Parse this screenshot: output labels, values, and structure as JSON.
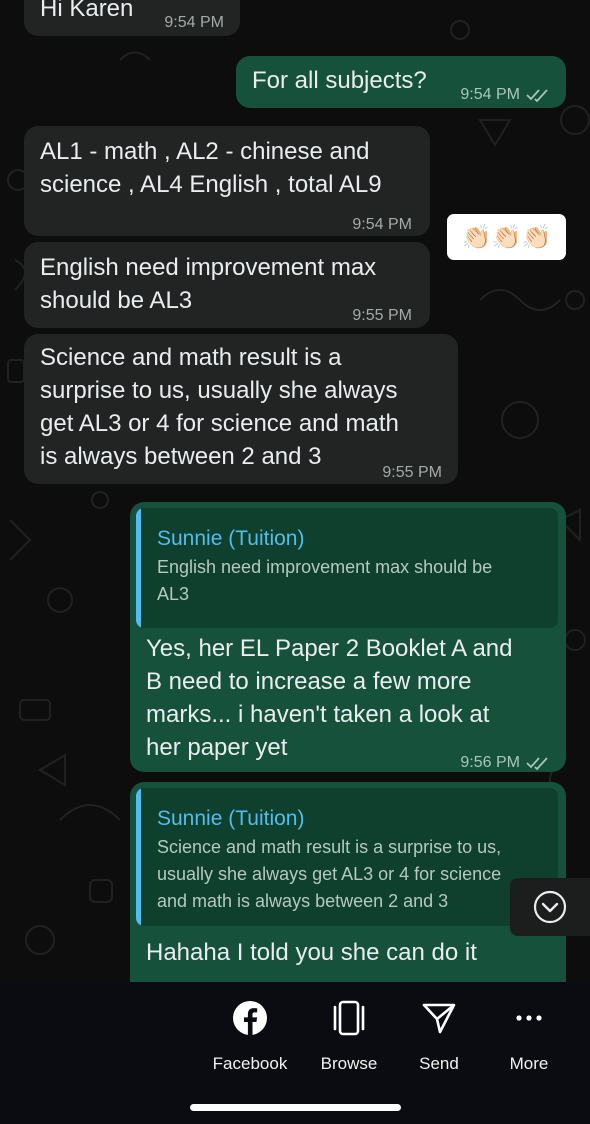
{
  "messages": [
    {
      "text": "Hi Karen",
      "time": "9:54 PM"
    },
    {
      "text": "For all subjects?",
      "time": "9:54 PM"
    },
    {
      "text": "AL1 - math , AL2 - chinese and\nscience , AL4 English , total AL9",
      "time": "9:54 PM"
    },
    {
      "text": "English need improvement max\nshould be AL3",
      "time": "9:55 PM"
    },
    {
      "text": "Science and math result is a\nsurprise to us, usually she always\nget AL3 or 4 for science and math\nis always between 2 and 3",
      "time": "9:55 PM"
    },
    {
      "quote_name": "Sunnie (Tuition)",
      "quote_text": "English need improvement max should be\nAL3",
      "text": "Yes, her EL Paper 2 Booklet A and\nB need to increase a few more\nmarks... i haven't taken a look at\nher paper yet",
      "time": "9:56 PM"
    },
    {
      "quote_name": "Sunnie (Tuition)",
      "quote_text": "Science and math result is a surprise to us,\nusually she always get AL3 or 4 for science\nand math is always between 2 and 3",
      "text": "Hahaha I told you she can do it"
    }
  ],
  "reaction": {
    "emoji": "👏🏻👏🏻👏🏻"
  },
  "actions": [
    {
      "label": "Facebook",
      "icon": "facebook-icon"
    },
    {
      "label": "Browse",
      "icon": "browse-icon"
    },
    {
      "label": "Send",
      "icon": "send-icon"
    },
    {
      "label": "More",
      "icon": "more-icon"
    }
  ],
  "colors": {
    "incoming": "#222424",
    "outgoing": "#15513b",
    "quote_accent": "#53bdeb"
  }
}
